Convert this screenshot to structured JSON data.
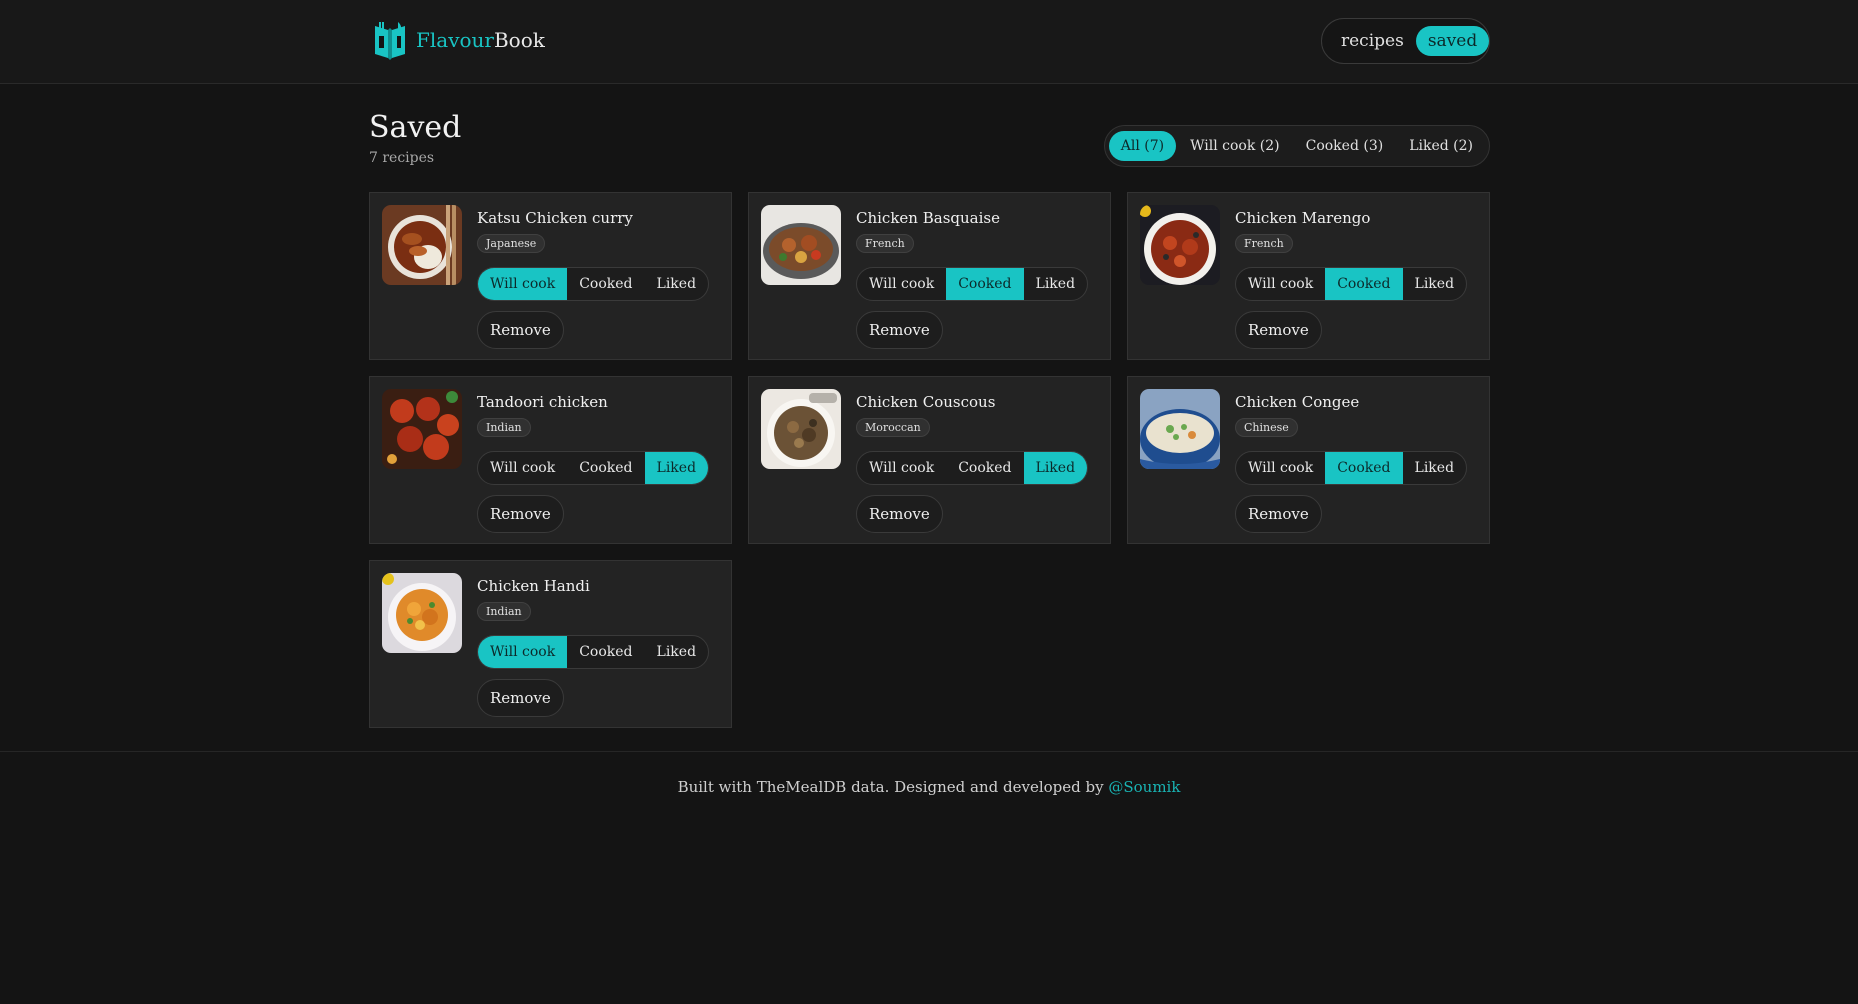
{
  "header": {
    "brand_part1": "Flavour",
    "brand_part2": "Book",
    "brand_icon": "open-book-utensils-icon",
    "nav": [
      {
        "label": "recipes",
        "active": false
      },
      {
        "label": "saved",
        "active": true
      }
    ]
  },
  "page": {
    "title": "Saved",
    "count": "7 recipes",
    "filters": [
      {
        "label": "All (7)",
        "active": true
      },
      {
        "label": "Will cook (2)",
        "active": false
      },
      {
        "label": "Cooked (3)",
        "active": false
      },
      {
        "label": "Liked (2)",
        "active": false
      }
    ]
  },
  "status_labels": [
    "Will cook",
    "Cooked",
    "Liked"
  ],
  "remove_label": "Remove",
  "recipes": [
    {
      "title": "Katsu Chicken curry",
      "cuisine": "Japanese",
      "status": "Will cook"
    },
    {
      "title": "Chicken Basquaise",
      "cuisine": "French",
      "status": "Cooked"
    },
    {
      "title": "Chicken Marengo",
      "cuisine": "French",
      "status": "Cooked"
    },
    {
      "title": "Tandoori chicken",
      "cuisine": "Indian",
      "status": "Liked"
    },
    {
      "title": "Chicken Couscous",
      "cuisine": "Moroccan",
      "status": "Liked"
    },
    {
      "title": "Chicken Congee",
      "cuisine": "Chinese",
      "status": "Cooked"
    },
    {
      "title": "Chicken Handi",
      "cuisine": "Indian",
      "status": "Will cook"
    }
  ],
  "footer": {
    "text": "Built with TheMealDB data. Designed and developed by ",
    "link": "@Soumik"
  },
  "colors": {
    "accent": "#19c4c4",
    "background": "#141414",
    "card": "#232323"
  }
}
